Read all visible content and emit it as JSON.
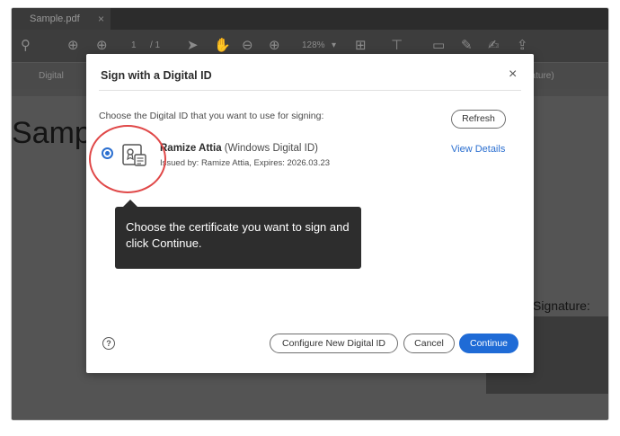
{
  "app": {
    "tab_title": "Sample.pdf",
    "tab_close": "×"
  },
  "toolbar": {
    "page_current": "1",
    "page_total": "/ 1",
    "zoom": "128%"
  },
  "subbar": {
    "left_label": "Digital",
    "right_label": "nature)"
  },
  "document": {
    "heading": "Sampl",
    "signature_label": "Signature:"
  },
  "dialog": {
    "title": "Sign with a Digital ID",
    "close": "×",
    "prompt": "Choose the Digital ID that you want to use for signing:",
    "refresh_label": "Refresh",
    "digital_id": {
      "name": "Ramize Attia",
      "type": "(Windows Digital ID)",
      "issued": "Issued by: Ramize Attia, Expires: 2026.03.23",
      "selected": true
    },
    "view_details_label": "View Details",
    "tooltip": "Choose the certificate you want to sign and click Continue.",
    "help": "?",
    "configure_label": "Configure New Digital ID",
    "cancel_label": "Cancel",
    "continue_label": "Continue"
  },
  "colors": {
    "accent": "#1f6bd6",
    "highlight": "#e04848",
    "tooltip_bg": "#2d2d2d"
  }
}
